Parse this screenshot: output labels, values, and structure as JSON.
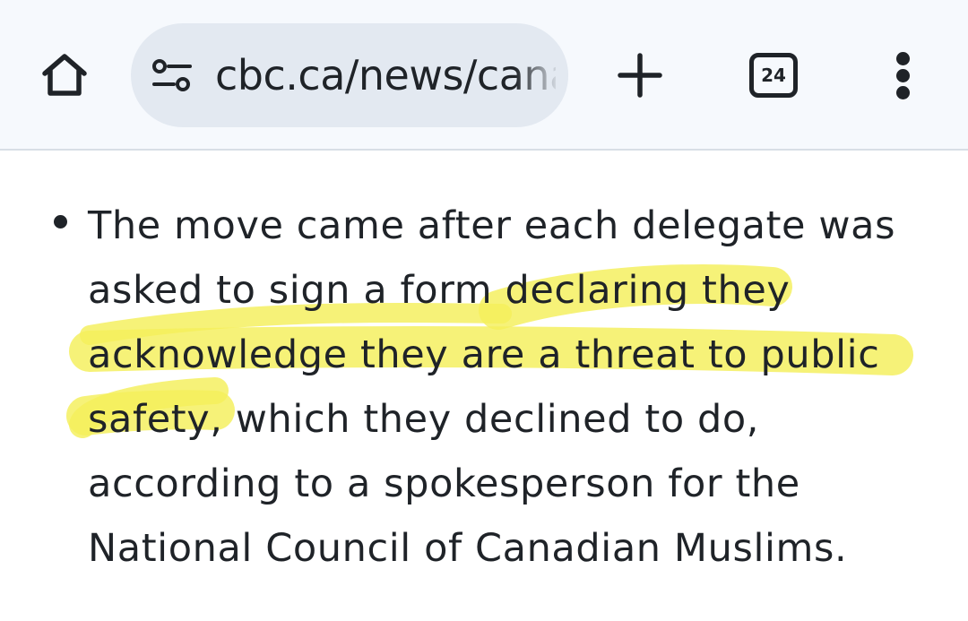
{
  "browser": {
    "url": "cbc.ca/news/cana",
    "tab_count": "24",
    "icons": {
      "home": "home-icon",
      "site_settings": "tune-icon",
      "new_tab": "plus-icon",
      "tabs": "tab-switcher-icon",
      "menu": "more-vert-icon"
    }
  },
  "article": {
    "bullet_lines": [
      "The move came after each delegate was",
      "asked to sign a form declaring they",
      "acknowledge they are a threat to public",
      "safety, which they declined to do,",
      "according to a spokesperson for the",
      "National Council of Canadian Muslims."
    ],
    "highlighted_phrase": "declaring they acknowledge they are a threat to public safety",
    "highlight_color": "#f4ef5a"
  },
  "colors": {
    "toolbar_bg": "#f6f9fd",
    "omnibox_bg": "#e3e9f1",
    "text": "#1f2328"
  }
}
